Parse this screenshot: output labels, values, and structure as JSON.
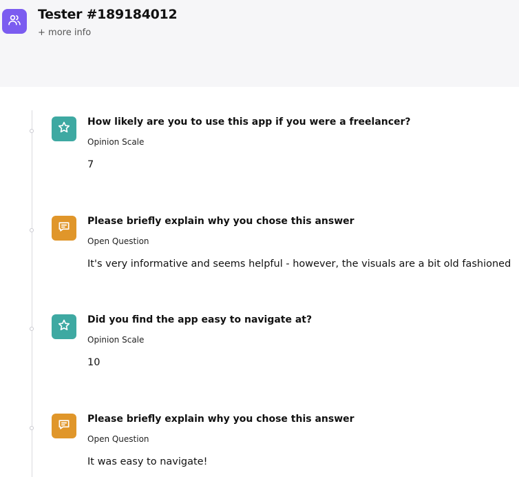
{
  "header": {
    "title": "Tester #189184012",
    "more_info": "+ more info",
    "avatar_icon": "users-icon"
  },
  "responses": [
    {
      "question": "How likely are you to use this app if you were a freelancer?",
      "type": "Opinion Scale",
      "answer": "7",
      "icon": "star-icon",
      "color": "#3ea9a2"
    },
    {
      "question": "Please briefly explain why you chose this answer",
      "type": "Open Question",
      "answer": "It's very informative and seems helpful - however, the visuals are a bit old fashioned",
      "icon": "message-icon",
      "color": "#e0962a"
    },
    {
      "question": "Did you find the app easy to navigate at?",
      "type": "Opinion Scale",
      "answer": "10",
      "icon": "star-icon",
      "color": "#3ea9a2"
    },
    {
      "question": "Please briefly explain why you chose this answer",
      "type": "Open Question",
      "answer": "It was easy to navigate!",
      "icon": "message-icon",
      "color": "#e0962a"
    }
  ]
}
